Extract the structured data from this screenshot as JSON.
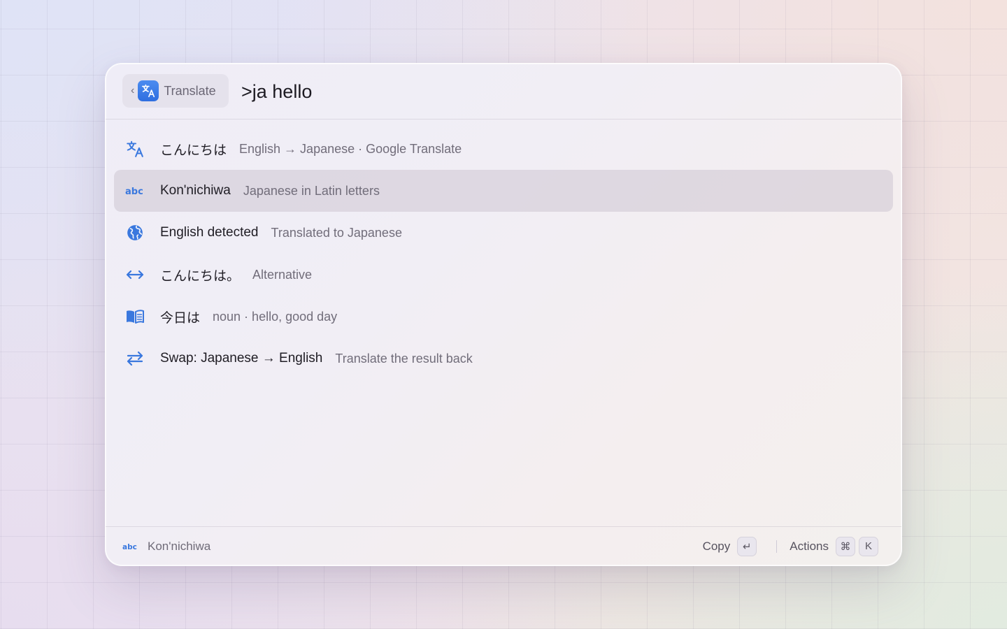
{
  "header": {
    "back_chip": {
      "chevron": "‹",
      "app_icon": "translate-icon",
      "label": "Translate"
    },
    "query": ">ja hello"
  },
  "results": [
    {
      "icon": "translate-icon",
      "title": "こんにちは",
      "subtitle": "English → Japanese · Google Translate",
      "selected": false
    },
    {
      "icon": "abc-icon",
      "title": "Kon'nichiwa",
      "subtitle": "Japanese in Latin letters",
      "selected": true
    },
    {
      "icon": "globe-icon",
      "title": "English detected",
      "subtitle": "Translated to Japanese",
      "selected": false
    },
    {
      "icon": "arrows-horizontal-icon",
      "title": "こんにちは。",
      "subtitle": "Alternative",
      "selected": false
    },
    {
      "icon": "book-icon",
      "title": "今日は",
      "subtitle": "noun · hello, good day",
      "selected": false
    },
    {
      "icon": "swap-icon",
      "title": "Swap: Japanese → English",
      "subtitle": "Translate the result back",
      "selected": false
    }
  ],
  "footer": {
    "icon": "abc-icon",
    "selection_label": "Kon'nichiwa",
    "primary_action": "Copy",
    "primary_key": "↵",
    "secondary_action": "Actions",
    "secondary_keys": [
      "⌘",
      "K"
    ]
  },
  "colors": {
    "accent": "#2f6fe0",
    "icon_blue": "#3a78de",
    "selected_row": "#dcd7e0"
  }
}
